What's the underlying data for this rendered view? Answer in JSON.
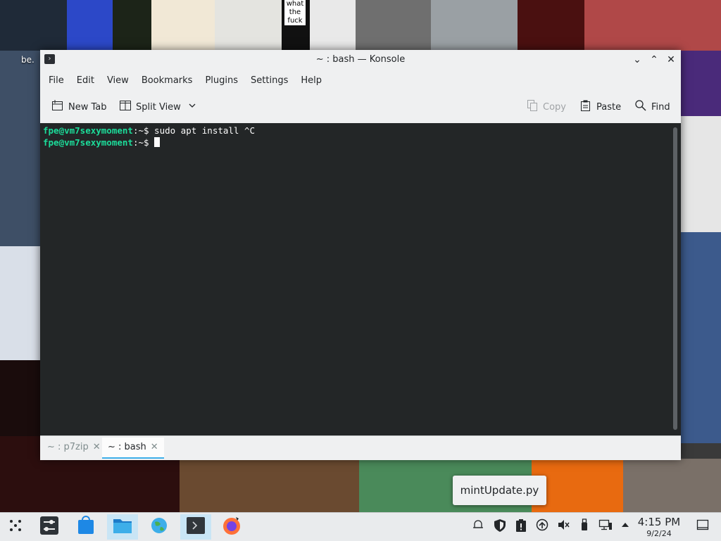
{
  "desktop": {
    "icon_label": "be.",
    "caption_text": "what the fuck"
  },
  "window": {
    "title": "~ : bash — Konsole",
    "controls": {
      "minimize": "⌄",
      "maximize": "⌃",
      "close": "✕"
    }
  },
  "menu": {
    "items": [
      "File",
      "Edit",
      "View",
      "Bookmarks",
      "Plugins",
      "Settings",
      "Help"
    ]
  },
  "toolbar": {
    "new_tab": "New Tab",
    "split_view": "Split View",
    "copy": "Copy",
    "paste": "Paste",
    "find": "Find"
  },
  "terminal": {
    "lines": [
      {
        "prompt": "fpe@vm7sexymoment",
        "path": ":~$",
        "command": " sudo apt install ^C"
      },
      {
        "prompt": "fpe@vm7sexymoment",
        "path": ":~$",
        "command": " "
      }
    ]
  },
  "tabs": [
    {
      "label": "~ : p7zip",
      "active": false
    },
    {
      "label": "~ : bash",
      "active": true
    }
  ],
  "tooltip": {
    "text": "mintUpdate.py"
  },
  "clock": {
    "time": "4:15 PM",
    "date": "9/2/24"
  },
  "colors": {
    "terminal_bg": "#232627",
    "prompt_green": "#1cdc9a",
    "accent": "#3daee9"
  }
}
